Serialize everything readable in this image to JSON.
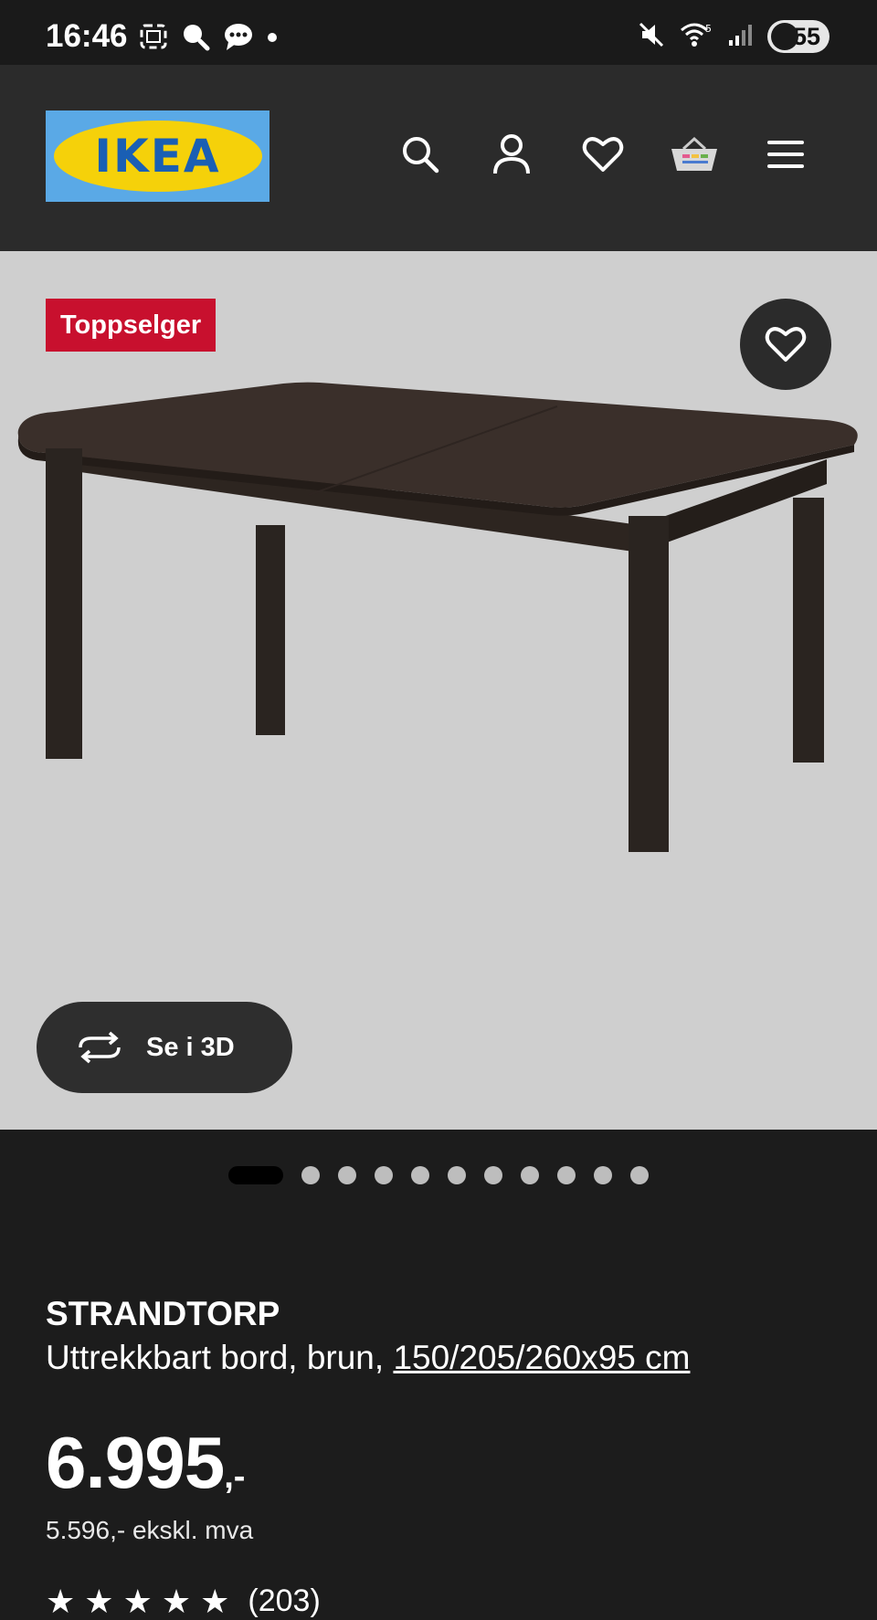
{
  "status_bar": {
    "time": "16:46",
    "battery": "55",
    "icons_left": [
      "screenshot-icon",
      "search-icon",
      "chat-icon",
      "dot-icon"
    ],
    "icons_right": [
      "mute-icon",
      "wifi-icon",
      "signal-icon",
      "battery-icon"
    ]
  },
  "header": {
    "logo_text": "IKEA",
    "icons": [
      "search-icon",
      "account-icon",
      "wishlist-icon",
      "cart-icon",
      "menu-icon"
    ]
  },
  "hero": {
    "badge": "Toppselger",
    "view_3d_label": "Se i 3D",
    "gallery_count": 11,
    "gallery_active_index": 0
  },
  "product": {
    "name": "STRANDTORP",
    "description": "Uttrekkbart bord, brun, ",
    "dimensions": "150/205/260x95 cm",
    "price_main": "6.995",
    "price_suffix": ",-",
    "price_ex_vat": "5.596,- ekskl. mva",
    "rating_stars": 5,
    "rating_count": "(203)"
  },
  "colors": {
    "header_bg": "#2b2b2b",
    "page_bg": "#1c1c1c",
    "hero_bg": "#cfcfcf",
    "badge_bg": "#c8102e",
    "logo_blue": "#5aa9e6",
    "logo_yellow": "#f5d10a"
  }
}
